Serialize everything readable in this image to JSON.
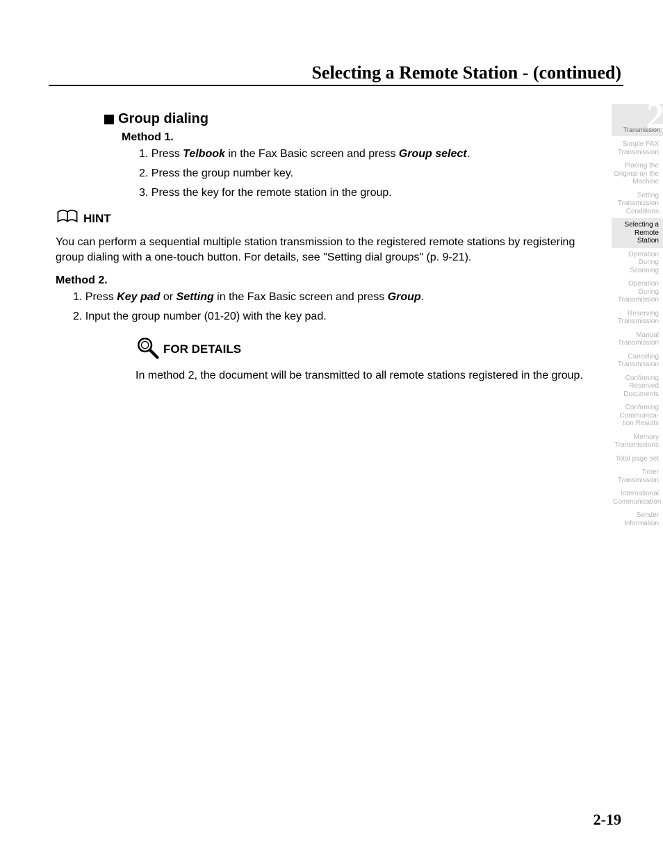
{
  "header": {
    "title": "Selecting a Remote Station -  (continued)"
  },
  "section_heading": "Group dialing",
  "methods": [
    {
      "label": "Method 1.",
      "steps_raw": [
        "1. Press {Telbook} in the Fax Basic screen and press {Group select}.",
        "2. Press the group number key.",
        "3. Press the key for the remote station in the group."
      ]
    },
    {
      "label": "Method 2.",
      "steps_raw": [
        "1. Press {Key pad} or {Setting} in the Fax Basic screen and press {Group}.",
        "2. Input the group number (01-20) with the key pad."
      ]
    }
  ],
  "hint": {
    "title": "HINT",
    "body": "You can perform a sequential multiple station transmission to the registered remote stations by registering group dialing with a one-touch button. For details, see \"Setting dial groups\" (p. 9-21)."
  },
  "details": {
    "title": "FOR DETAILS",
    "body": "In method 2, the document will be transmitted to all remote stations registered in the group."
  },
  "page_number": "2-19",
  "sidebar": {
    "chapter_number": "2",
    "chapter_label": "Transmission",
    "items": [
      "Simple FAX Transmission",
      "Placing the Original on the Machine",
      "Setting Transmission Conditions",
      "Selecting a Remote Station",
      "Operation During Scanning",
      "Operation During Transmission",
      "Reserving Transmission",
      "Manual Transmission",
      "Canceling Transmission",
      "Confirming Reserved Documents",
      "Confirming Communica- tion Results",
      "Memory Transmissions",
      "Total page set",
      "Timer Transmission",
      "International Communication",
      "Sender Information"
    ],
    "active_index": 3
  }
}
